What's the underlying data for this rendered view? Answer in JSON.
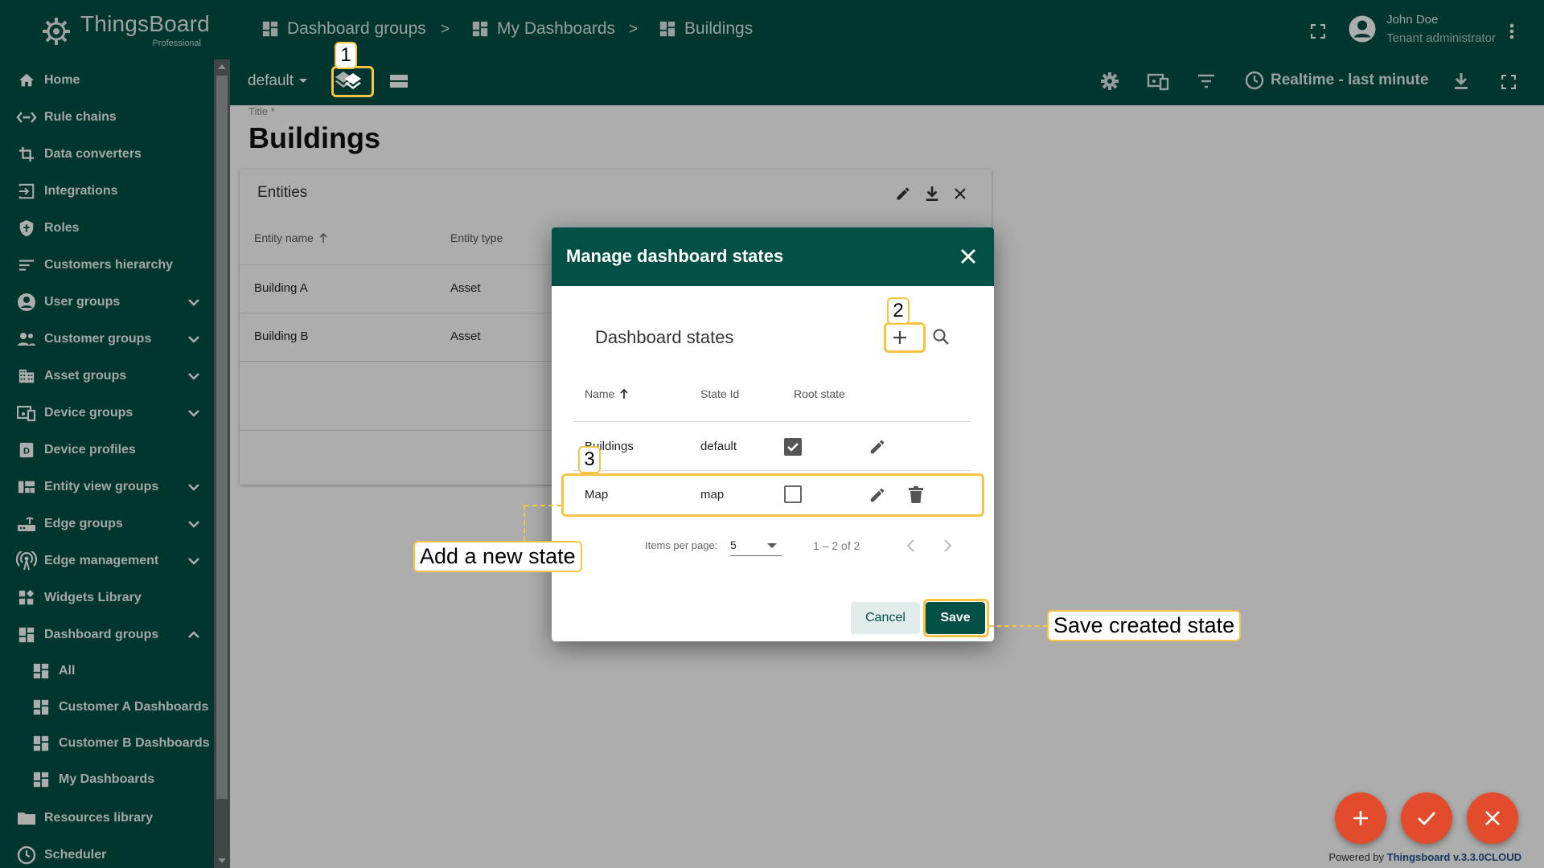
{
  "sidebar": {
    "logo_text": "ThingsBoard",
    "logo_subtext": "Professional",
    "items": [
      {
        "label": "Home",
        "icon": "home-icon"
      },
      {
        "label": "Rule chains",
        "icon": "rule-chain-icon"
      },
      {
        "label": "Data converters",
        "icon": "converter-icon"
      },
      {
        "label": "Integrations",
        "icon": "integration-icon"
      },
      {
        "label": "Roles",
        "icon": "shield-icon"
      },
      {
        "label": "Customers hierarchy",
        "icon": "hierarchy-icon"
      },
      {
        "label": "User groups",
        "icon": "account-icon",
        "expandable": true
      },
      {
        "label": "Customer groups",
        "icon": "people-icon",
        "expandable": true
      },
      {
        "label": "Asset groups",
        "icon": "domain-icon",
        "expandable": true
      },
      {
        "label": "Device groups",
        "icon": "devices-icon",
        "expandable": true
      },
      {
        "label": "Device profiles",
        "icon": "device-profile-icon"
      },
      {
        "label": "Entity view groups",
        "icon": "view-quilt-icon",
        "expandable": true
      },
      {
        "label": "Edge groups",
        "icon": "router-icon",
        "expandable": true
      },
      {
        "label": "Edge management",
        "icon": "antenna-icon",
        "expandable": true
      },
      {
        "label": "Widgets Library",
        "icon": "widgets-icon"
      },
      {
        "label": "Dashboard groups",
        "icon": "dashboard-icon",
        "expanded": true
      },
      {
        "label": "All",
        "icon": "dashboard-icon",
        "sub": true
      },
      {
        "label": "Customer A Dashboards",
        "icon": "dashboard-icon",
        "sub": true
      },
      {
        "label": "Customer B Dashboards",
        "icon": "dashboard-icon",
        "sub": true
      },
      {
        "label": "My Dashboards",
        "icon": "dashboard-icon",
        "sub": true
      },
      {
        "label": "Resources library",
        "icon": "folder-icon"
      },
      {
        "label": "Scheduler",
        "icon": "clock-icon"
      }
    ]
  },
  "topbar": {
    "breadcrumbs": [
      "Dashboard groups",
      "My Dashboards",
      "Buildings"
    ],
    "separator": ">",
    "user_name": "John Doe",
    "user_role": "Tenant administrator",
    "state_select": "default",
    "timewindow": "Realtime - last minute"
  },
  "page": {
    "title_label": "Title *",
    "title": "Buildings"
  },
  "widget": {
    "title": "Entities",
    "columns": [
      "Entity name",
      "Entity type"
    ],
    "rows": [
      [
        "Building A",
        "Asset"
      ],
      [
        "Building B",
        "Asset"
      ]
    ]
  },
  "dialog": {
    "title": "Manage dashboard states",
    "section_title": "Dashboard states",
    "columns": [
      "Name",
      "State Id",
      "Root state"
    ],
    "rows": [
      {
        "name": "Buildings",
        "state_id": "default",
        "root": true
      },
      {
        "name": "Map",
        "state_id": "map",
        "root": false
      }
    ],
    "items_per_page_label": "Items per page:",
    "items_per_page": "5",
    "range": "1 – 2 of 2",
    "cancel_label": "Cancel",
    "save_label": "Save"
  },
  "annotations": {
    "num1": "1",
    "num2": "2",
    "num3": "3",
    "add_state": "Add a new state",
    "save_state": "Save created state",
    "color": "#f6c343"
  },
  "footer": {
    "powered_prefix": "Powered by ",
    "powered_brand": "Thingsboard v.3.3.0CLOUD"
  },
  "colors": {
    "primary": "#015045",
    "fab": "#e24b2c"
  }
}
